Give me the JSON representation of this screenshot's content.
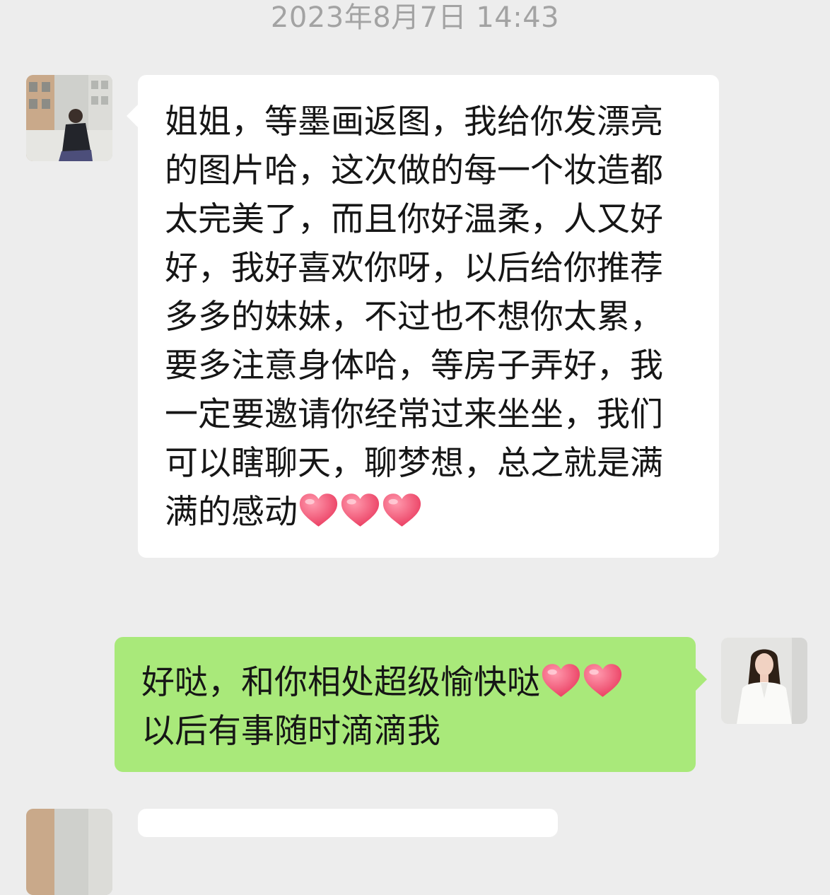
{
  "chat": {
    "timestamp": "2023年8月7日 14:43",
    "messages": [
      {
        "sender": "contact",
        "text": "姐姐，等墨画返图，我给你发漂亮的图片哈，这次做的每一个妆造都太完美了，而且你好温柔，人又好好，我好喜欢你呀，以后给你推荐多多的妹妹，不过也不想你太累，要多注意身体哈，等房子弄好，我一定要邀请你经常过来坐坐，我们可以瞎聊天，聊梦想，总之就是满满的感动",
        "trailing_icons": [
          "heart-emoji",
          "heart-emoji",
          "heart-emoji"
        ]
      },
      {
        "sender": "me",
        "text_line1": "好哒，和你相处超级愉快哒",
        "line1_icons": [
          "heart-emoji",
          "heart-emoji"
        ],
        "text_line2": "以后有事随时滴滴我"
      }
    ]
  },
  "colors": {
    "background": "#ededed",
    "incoming_bubble": "#ffffff",
    "outgoing_bubble": "#a9e97a",
    "timestamp_text": "#a3a3a3",
    "heart": "#f0506e"
  }
}
